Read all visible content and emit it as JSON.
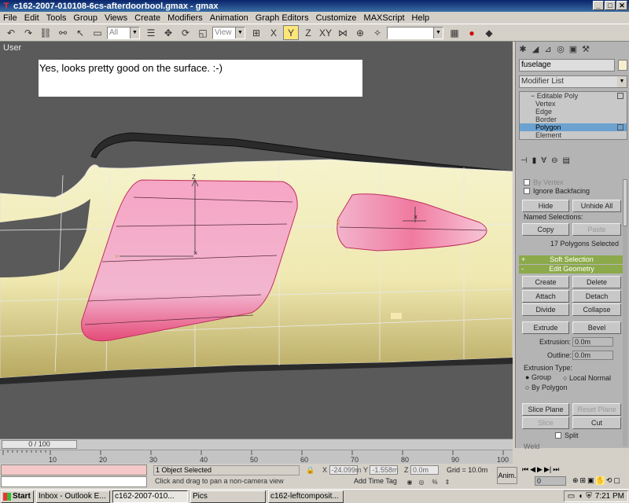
{
  "window": {
    "title": "c162-2007-010108-6cs-afterdoorbool.gmax - gmax",
    "minimize": "_",
    "maximize": "□",
    "close": "✕"
  },
  "menu": [
    "File",
    "Edit",
    "Tools",
    "Group",
    "Views",
    "Create",
    "Modifiers",
    "Animation",
    "Graph Editors",
    "Customize",
    "MAXScript",
    "Help"
  ],
  "toolbar": {
    "selection_filter": "All",
    "reference_coord": "View"
  },
  "viewport": {
    "label": "User",
    "comment": "Yes, looks pretty good on the surface. :-)",
    "colors": {
      "fuselage": "#f2efc0",
      "selection": "#f28aa8",
      "background": "#5a5a5a"
    }
  },
  "command_panel": {
    "object_name": "fuselage",
    "modifier_list": "Modifier List",
    "stack": {
      "root": "Editable Poly",
      "items": [
        "Vertex",
        "Edge",
        "Border",
        "Polygon",
        "Element"
      ],
      "selected": "Polygon"
    },
    "selection": {
      "by_vertex": "By Vertex",
      "ignore_backfacing": "Ignore Backfacing",
      "hide": "Hide",
      "unhide_all": "Unhide All",
      "named_selections": "Named Selections:",
      "copy": "Copy",
      "paste": "Paste",
      "status": "17 Polygons Selected"
    },
    "soft_selection": {
      "sign": "+",
      "label": "Soft Selection"
    },
    "edit_geometry": {
      "sign": "-",
      "label": "Edit Geometry",
      "create": "Create",
      "delete": "Delete",
      "attach": "Attach",
      "detach": "Detach",
      "divide": "Divide",
      "collapse": "Collapse",
      "extrude": "Extrude",
      "bevel": "Bevel",
      "extrusion_label": "Extrusion:",
      "extrusion_value": "0.0m",
      "outline_label": "Outline:",
      "outline_value": "0.0m",
      "extrusion_type": "Extrusion Type:",
      "group": "Group",
      "local_normal": "Local Normal",
      "by_polygon": "By Polygon",
      "slice_plane": "Slice Plane",
      "reset_plane": "Reset Plane",
      "slice": "Slice",
      "cut": "Cut",
      "split": "Split",
      "weld": "Weld"
    }
  },
  "timeline": {
    "frame": "0 / 100",
    "ticks": [
      "10",
      "20",
      "30",
      "40",
      "50",
      "60",
      "70",
      "80",
      "90",
      "100"
    ]
  },
  "status": {
    "selected": "1 Object Selected",
    "prompt": "Click and drag to pan a non-camera view",
    "x_label": "X",
    "x": "-24.099m",
    "y_label": "Y",
    "y": "-1.558m",
    "z_label": "Z",
    "z": "0.0m",
    "grid": "Grid = 10.0m",
    "add_time_tag": "Add Time Tag",
    "anim": "Anim.",
    "frame_spinner": "0"
  },
  "taskbar": {
    "start": "Start",
    "tasks": [
      "Inbox - Outlook E...",
      "c162-2007-010...",
      "Pics",
      "c162-leftcomposit..."
    ],
    "clock": "7:21 PM"
  }
}
